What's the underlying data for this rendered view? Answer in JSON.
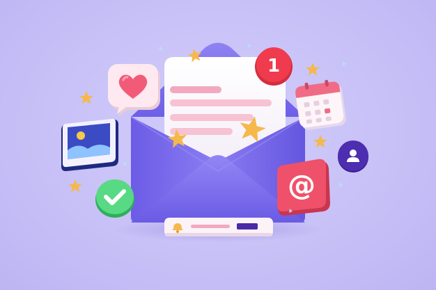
{
  "notification": {
    "count": "1"
  },
  "email_symbol": "@",
  "icons": {
    "envelope": "envelope-icon",
    "letter": "letter-icon",
    "heart": "heart-chat-icon",
    "calendar": "calendar-icon",
    "image": "image-icon",
    "check": "checkmark-icon",
    "user": "user-icon",
    "at": "at-sign-icon",
    "bell": "bell-icon",
    "star": "star-icon"
  },
  "colors": {
    "background": "#c7c0f7",
    "envelope": "#7d6ef0",
    "badge": "#f03b4e",
    "heart_card": "#fbe8ee",
    "heart": "#f25b78",
    "calendar_header": "#f06c86",
    "image_tile": "#2f3ea6",
    "check": "#54d67f",
    "user_circle": "#4a2aa8",
    "at_tile": "#f0516a",
    "star": "#f5b84a"
  }
}
